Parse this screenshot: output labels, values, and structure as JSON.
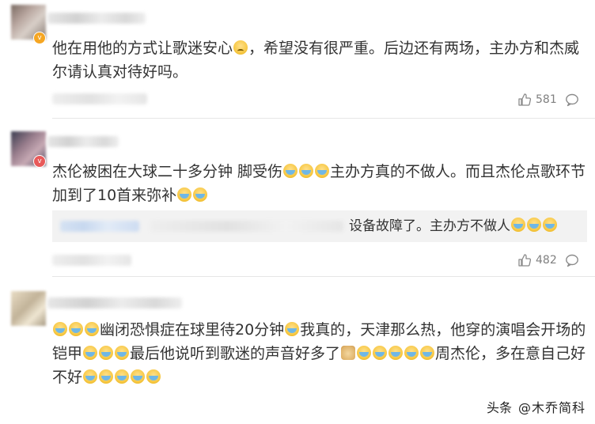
{
  "comments": [
    {
      "text_a": "他在用他的方式让歌迷安心",
      "text_b": "，希望没有很严重。后边还有两场，主办方和杰威尔请认真对待好吗。",
      "likes": "581"
    },
    {
      "text_a": "杰伦被困在大球二十多分钟 脚受伤",
      "text_b": "主办方真的不做人。而且杰伦点歌环节加到了10首来弥补",
      "reply_text": "设备故障了。主办方不做人",
      "likes": "482"
    },
    {
      "text_a": "幽闭恐惧症在球里待20分钟",
      "text_b": "我真的，天津那么热，他穿的演唱会开场的铠甲",
      "text_c": "最后他说听到歌迷的声音好多了",
      "text_d": "周杰伦，多在意自己好不好"
    }
  ],
  "watermark": {
    "prefix": "头条",
    "handle": "@木乔简科"
  },
  "icons": {
    "like": "thumbs-up-icon",
    "reply": "comment-bubble-icon",
    "emoji_cry": "crying-face-emoji",
    "emoji_sad": "worried-face-emoji",
    "emoji_dog": "doge-emoji"
  },
  "colors": {
    "text": "#333333",
    "meta": "#808080",
    "reply_bg": "#f2f2f2",
    "badge": "#f5a623"
  }
}
